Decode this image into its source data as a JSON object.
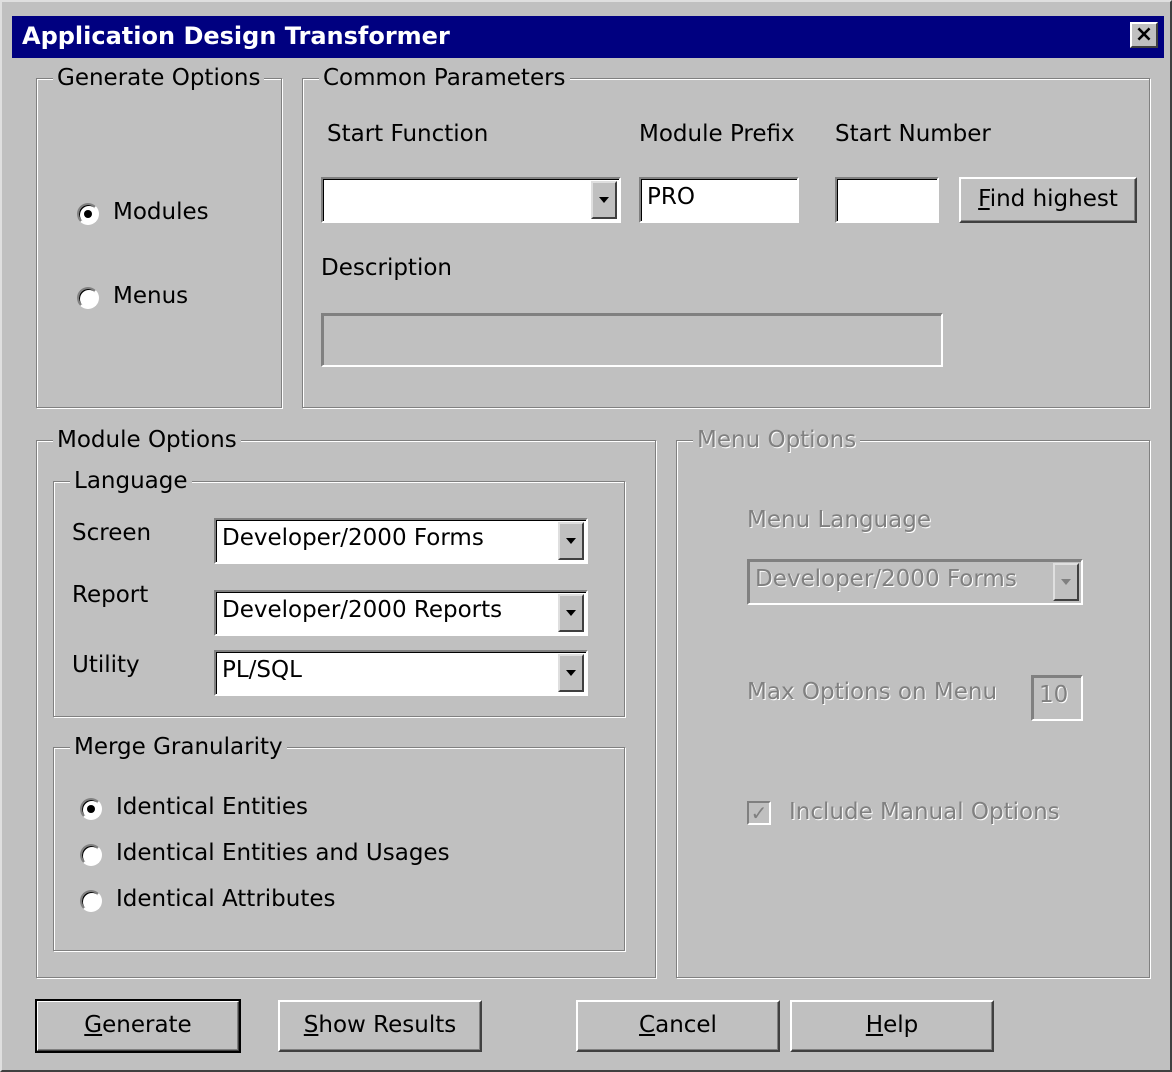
{
  "window": {
    "title": "Application Design Transformer",
    "close_glyph": "×"
  },
  "generate_options": {
    "legend": "Generate Options",
    "options": [
      {
        "label": "Modules",
        "selected": true
      },
      {
        "label": "Menus",
        "selected": false
      }
    ]
  },
  "common_parameters": {
    "legend": "Common Parameters",
    "start_function_label": "Start Function",
    "start_function_value": "",
    "module_prefix_label": "Module Prefix",
    "module_prefix_value": "PRO",
    "start_number_label": "Start Number",
    "start_number_value": "",
    "find_highest_button": {
      "mnemonic": "F",
      "rest": "ind highest"
    },
    "description_label": "Description",
    "description_value": ""
  },
  "module_options": {
    "legend": "Module Options",
    "language": {
      "legend": "Language",
      "screen_label": "Screen",
      "screen_value": "Developer/2000 Forms",
      "report_label": "Report",
      "report_value": "Developer/2000 Reports",
      "utility_label": "Utility",
      "utility_value": "PL/SQL"
    },
    "merge_granularity": {
      "legend": "Merge Granularity",
      "options": [
        {
          "label": "Identical Entities",
          "selected": true
        },
        {
          "label": "Identical Entities and Usages",
          "selected": false
        },
        {
          "label": "Identical Attributes",
          "selected": false
        }
      ]
    }
  },
  "menu_options": {
    "legend": "Menu Options",
    "menu_language_label": "Menu Language",
    "menu_language_value": "Developer/2000 Forms",
    "max_options_label": "Max Options on Menu",
    "max_options_value": "10",
    "include_manual_label": "Include Manual Options",
    "include_manual_checked": true,
    "enabled": false
  },
  "buttons": {
    "generate": {
      "mnemonic": "G",
      "rest": "enerate"
    },
    "show_results": {
      "mnemonic": "S",
      "rest": "how Results"
    },
    "cancel": {
      "mnemonic": "C",
      "rest": "ancel"
    },
    "help": {
      "mnemonic": "H",
      "rest": "elp"
    }
  }
}
